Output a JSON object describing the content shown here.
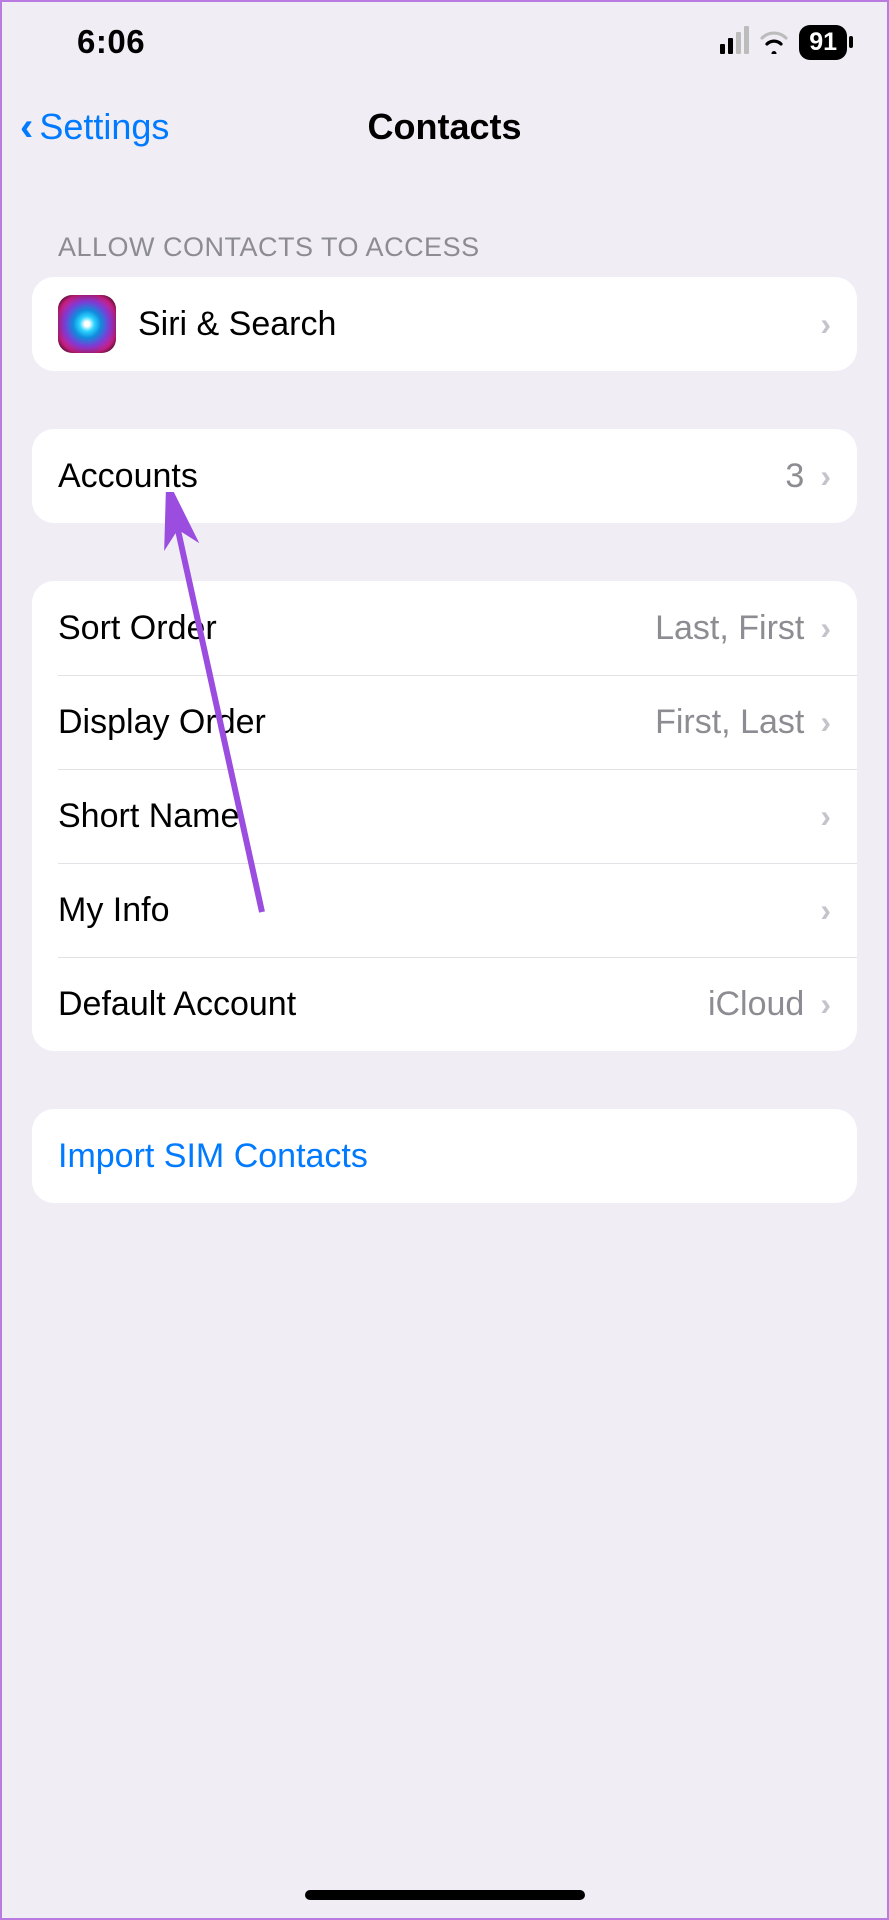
{
  "status": {
    "time": "6:06",
    "battery": "91"
  },
  "nav": {
    "back_label": "Settings",
    "title": "Contacts"
  },
  "section1_header": "ALLOW CONTACTS TO ACCESS",
  "rows": {
    "siri": "Siri & Search",
    "accounts_label": "Accounts",
    "accounts_value": "3",
    "sort_label": "Sort Order",
    "sort_value": "Last, First",
    "display_label": "Display Order",
    "display_value": "First, Last",
    "shortname_label": "Short Name",
    "myinfo_label": "My Info",
    "default_label": "Default Account",
    "default_value": "iCloud",
    "import_label": "Import SIM Contacts"
  }
}
